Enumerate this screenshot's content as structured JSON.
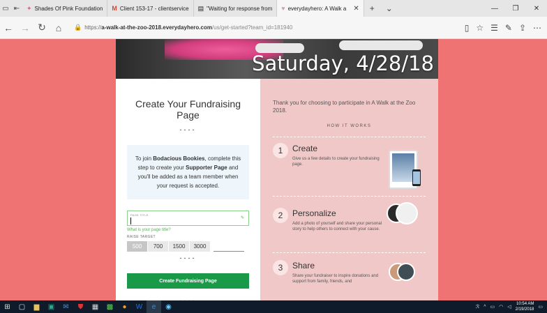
{
  "browser": {
    "tabs": [
      {
        "title": "Shades Of Pink Foundation",
        "icon": "pink-ribbon-icon",
        "active": false
      },
      {
        "title": "Client 153-17 - clientservice",
        "icon": "gmail-icon",
        "active": false
      },
      {
        "title": "\"Waiting for response from",
        "icon": "window-icon",
        "active": false
      },
      {
        "title": "everydayhero: A Walk a",
        "icon": "heart-icon",
        "active": true
      }
    ],
    "url": {
      "prefix": "https://",
      "domain": "a-walk-at-the-zoo-2018.everydayhero.com",
      "path": "/us/get-started?team_id=181940"
    }
  },
  "hero": {
    "date": "Saturday, 4/28/18"
  },
  "left": {
    "title": "Create Your Fundraising Page",
    "dashes": "----",
    "join_before": "To join ",
    "team_name": "Bodacious Bookies",
    "join_mid": ", complete this step to create your ",
    "supporter_page": "Supporter Page",
    "join_after": " and you'll be added as a team member when your request is accepted.",
    "page_title_label": "PAGE TITLE",
    "page_title_hint": "What is your page title?",
    "raise_target_label": "RAISE TARGET",
    "amounts": [
      "500",
      "700",
      "1500",
      "3000"
    ],
    "selected_amount_index": 0,
    "cta_label": "Create Fundraising Page"
  },
  "right": {
    "thanks": "Thank you for choosing to participate in A Walk at the Zoo 2018.",
    "how_it_works": "HOW IT WORKS",
    "steps": [
      {
        "num": "1",
        "name": "Create",
        "desc": "Give us a few details to create your fundraising page."
      },
      {
        "num": "2",
        "name": "Personalize",
        "desc": "Add a photo of yourself and share your personal story to help others to connect with your cause."
      },
      {
        "num": "3",
        "name": "Share",
        "desc": "Share your fundraiser to inspire donations and support from family, friends, and"
      }
    ]
  },
  "taskbar": {
    "time": "10:54 AM",
    "date": "2/19/2018"
  },
  "colors": {
    "page_bg": "#f07373",
    "cta_green": "#1a9a48",
    "right_panel": "#f1c8c8",
    "info_box": "#eef6fb"
  }
}
